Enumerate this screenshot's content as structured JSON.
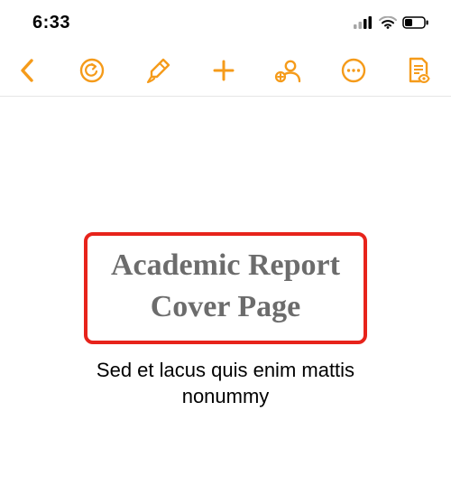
{
  "status": {
    "time": "6:33"
  },
  "toolbar": {
    "icons": {
      "back": "chevron-left-icon",
      "undo": "undo-icon",
      "brush": "paintbrush-icon",
      "add": "plus-icon",
      "collaborate": "add-person-icon",
      "more": "ellipsis-icon",
      "view_settings": "document-view-icon"
    }
  },
  "document": {
    "title": "Academic Report\nCover Page",
    "subtitle": "Sed et lacus quis enim mattis nonummy"
  },
  "colors": {
    "accent": "#f59b1a",
    "highlight": "#e7231b"
  }
}
